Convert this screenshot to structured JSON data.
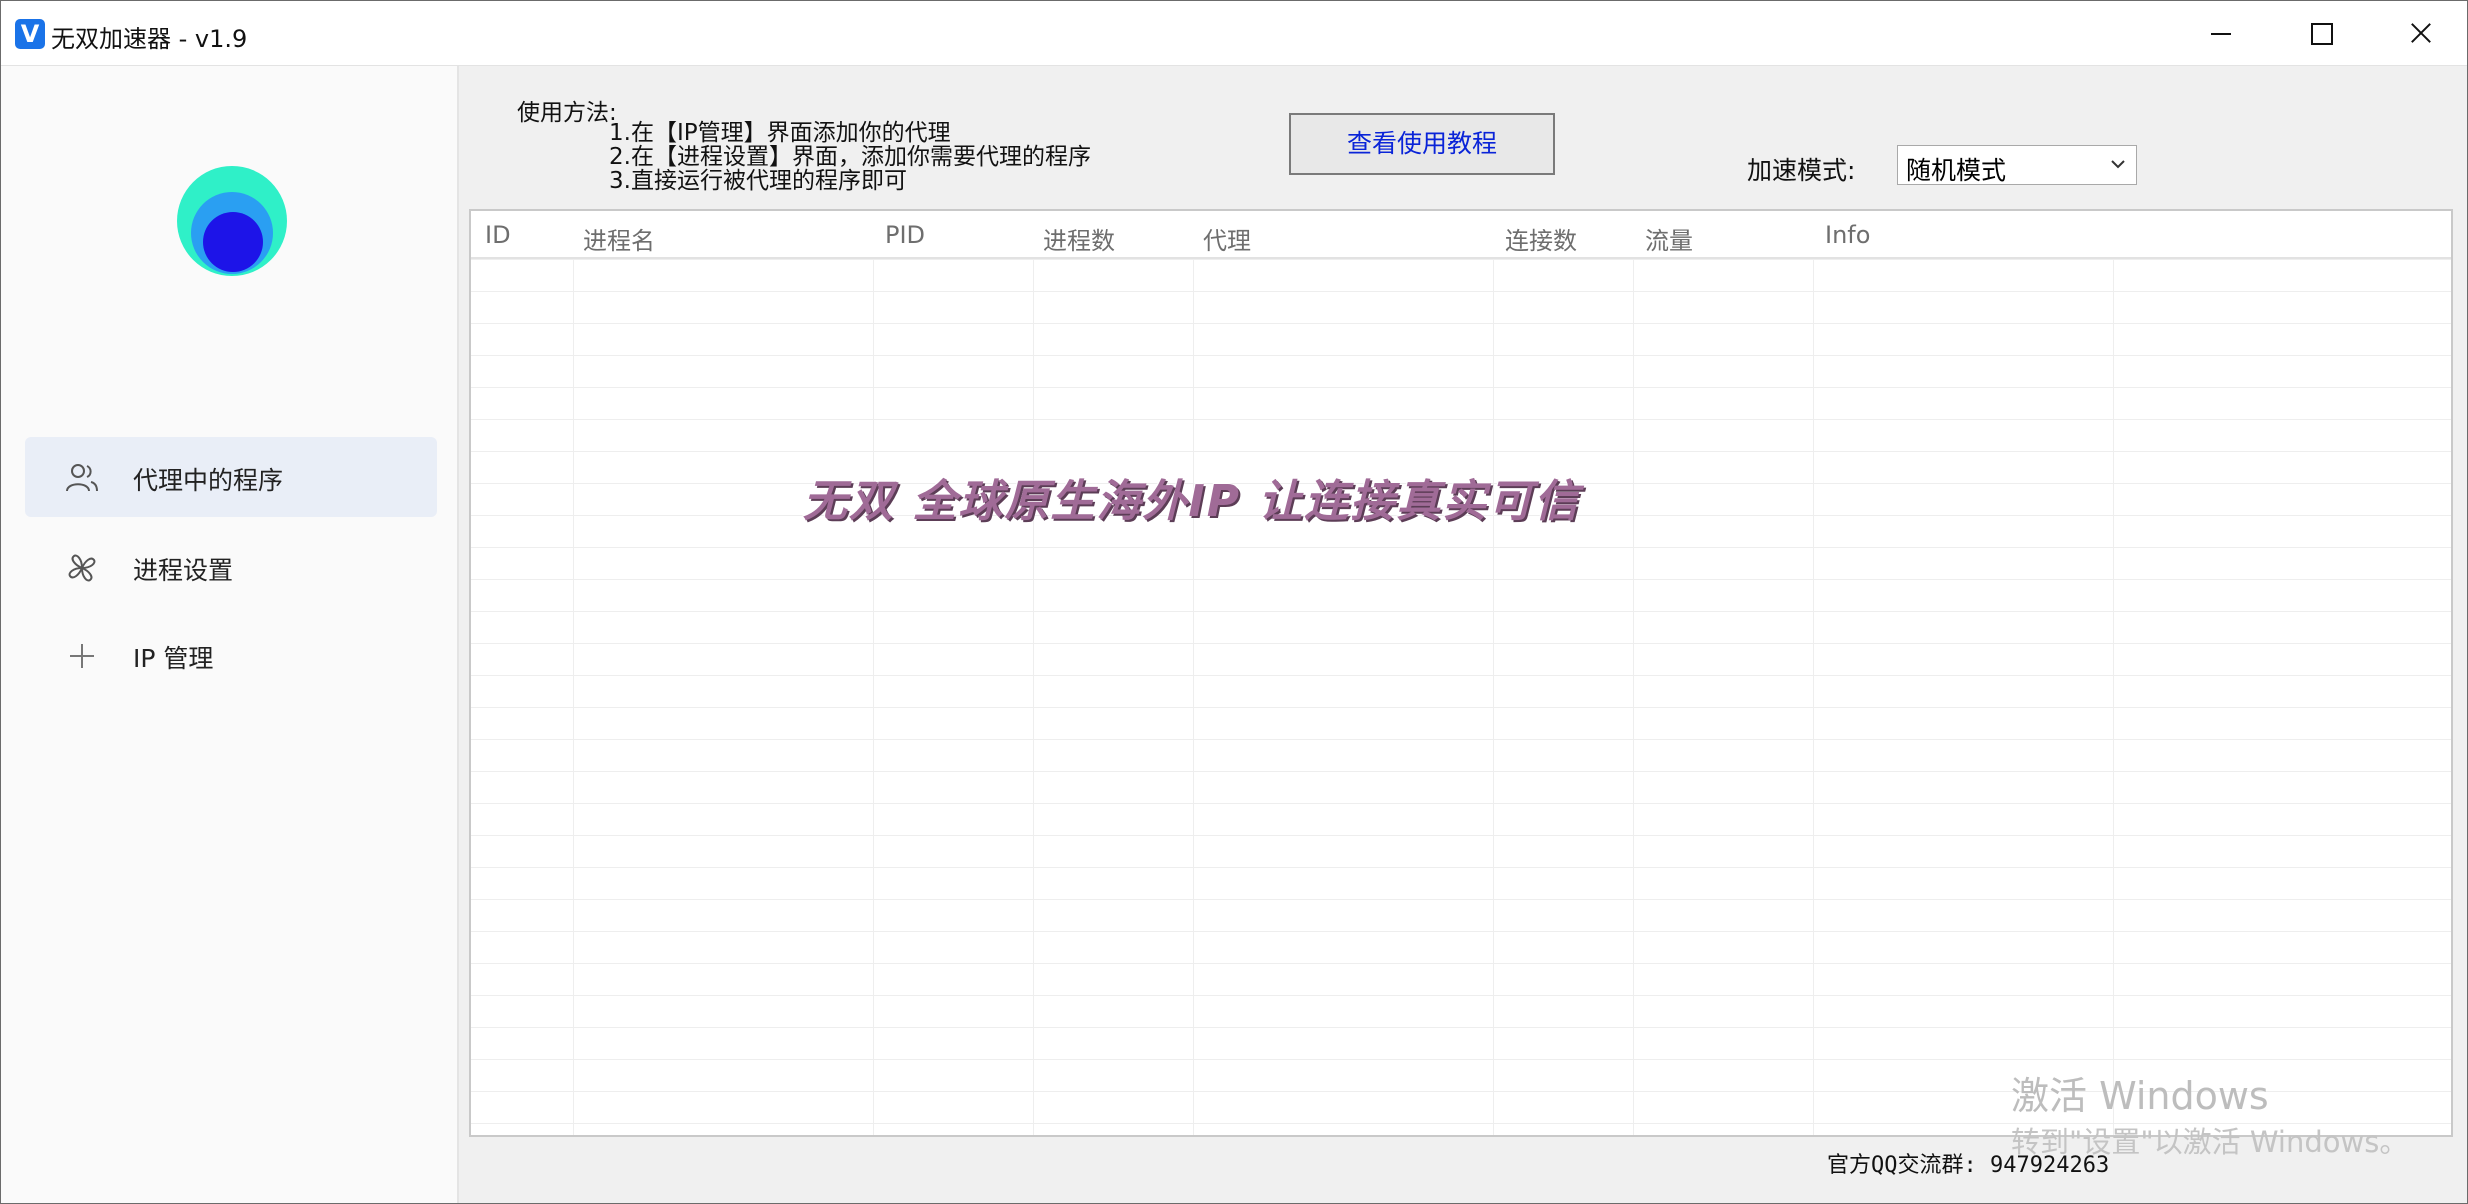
{
  "window": {
    "title": "无双加速器 - v1.9",
    "app_icon_letter": "V",
    "accent": "#1a73e8"
  },
  "sidebar": {
    "items": [
      {
        "label": "代理中的程序",
        "icon": "users-icon",
        "active": true
      },
      {
        "label": "进程设置",
        "icon": "process-settings-icon",
        "active": false
      },
      {
        "label": "IP 管理",
        "icon": "plus-icon",
        "active": false
      }
    ]
  },
  "usage": {
    "title": "使用方法:",
    "steps": [
      "1.在【IP管理】界面添加你的代理",
      "2.在【进程设置】界面，添加你需要代理的程序",
      "3.直接运行被代理的程序即可"
    ]
  },
  "toolbar": {
    "tutorial_button": "查看使用教程",
    "mode_label": "加速模式:",
    "mode_value": "随机模式"
  },
  "table": {
    "columns": [
      "ID",
      "进程名",
      "PID",
      "进程数",
      "代理",
      "连接数",
      "流量",
      "Info"
    ],
    "rows": []
  },
  "banner": "无双 全球原生海外IP 让连接真实可信",
  "footer": "官方QQ交流群: 947924263",
  "activation": {
    "title": "激活 Windows",
    "subtitle": "转到\"设置\"以激活 Windows。"
  },
  "colors": {
    "logo_outer": "#2ff0c8",
    "logo_middle": "#2a9ff2",
    "logo_inner": "#1d14e8",
    "banner": "#a06b97",
    "tutorial_text": "#0a24d8"
  }
}
